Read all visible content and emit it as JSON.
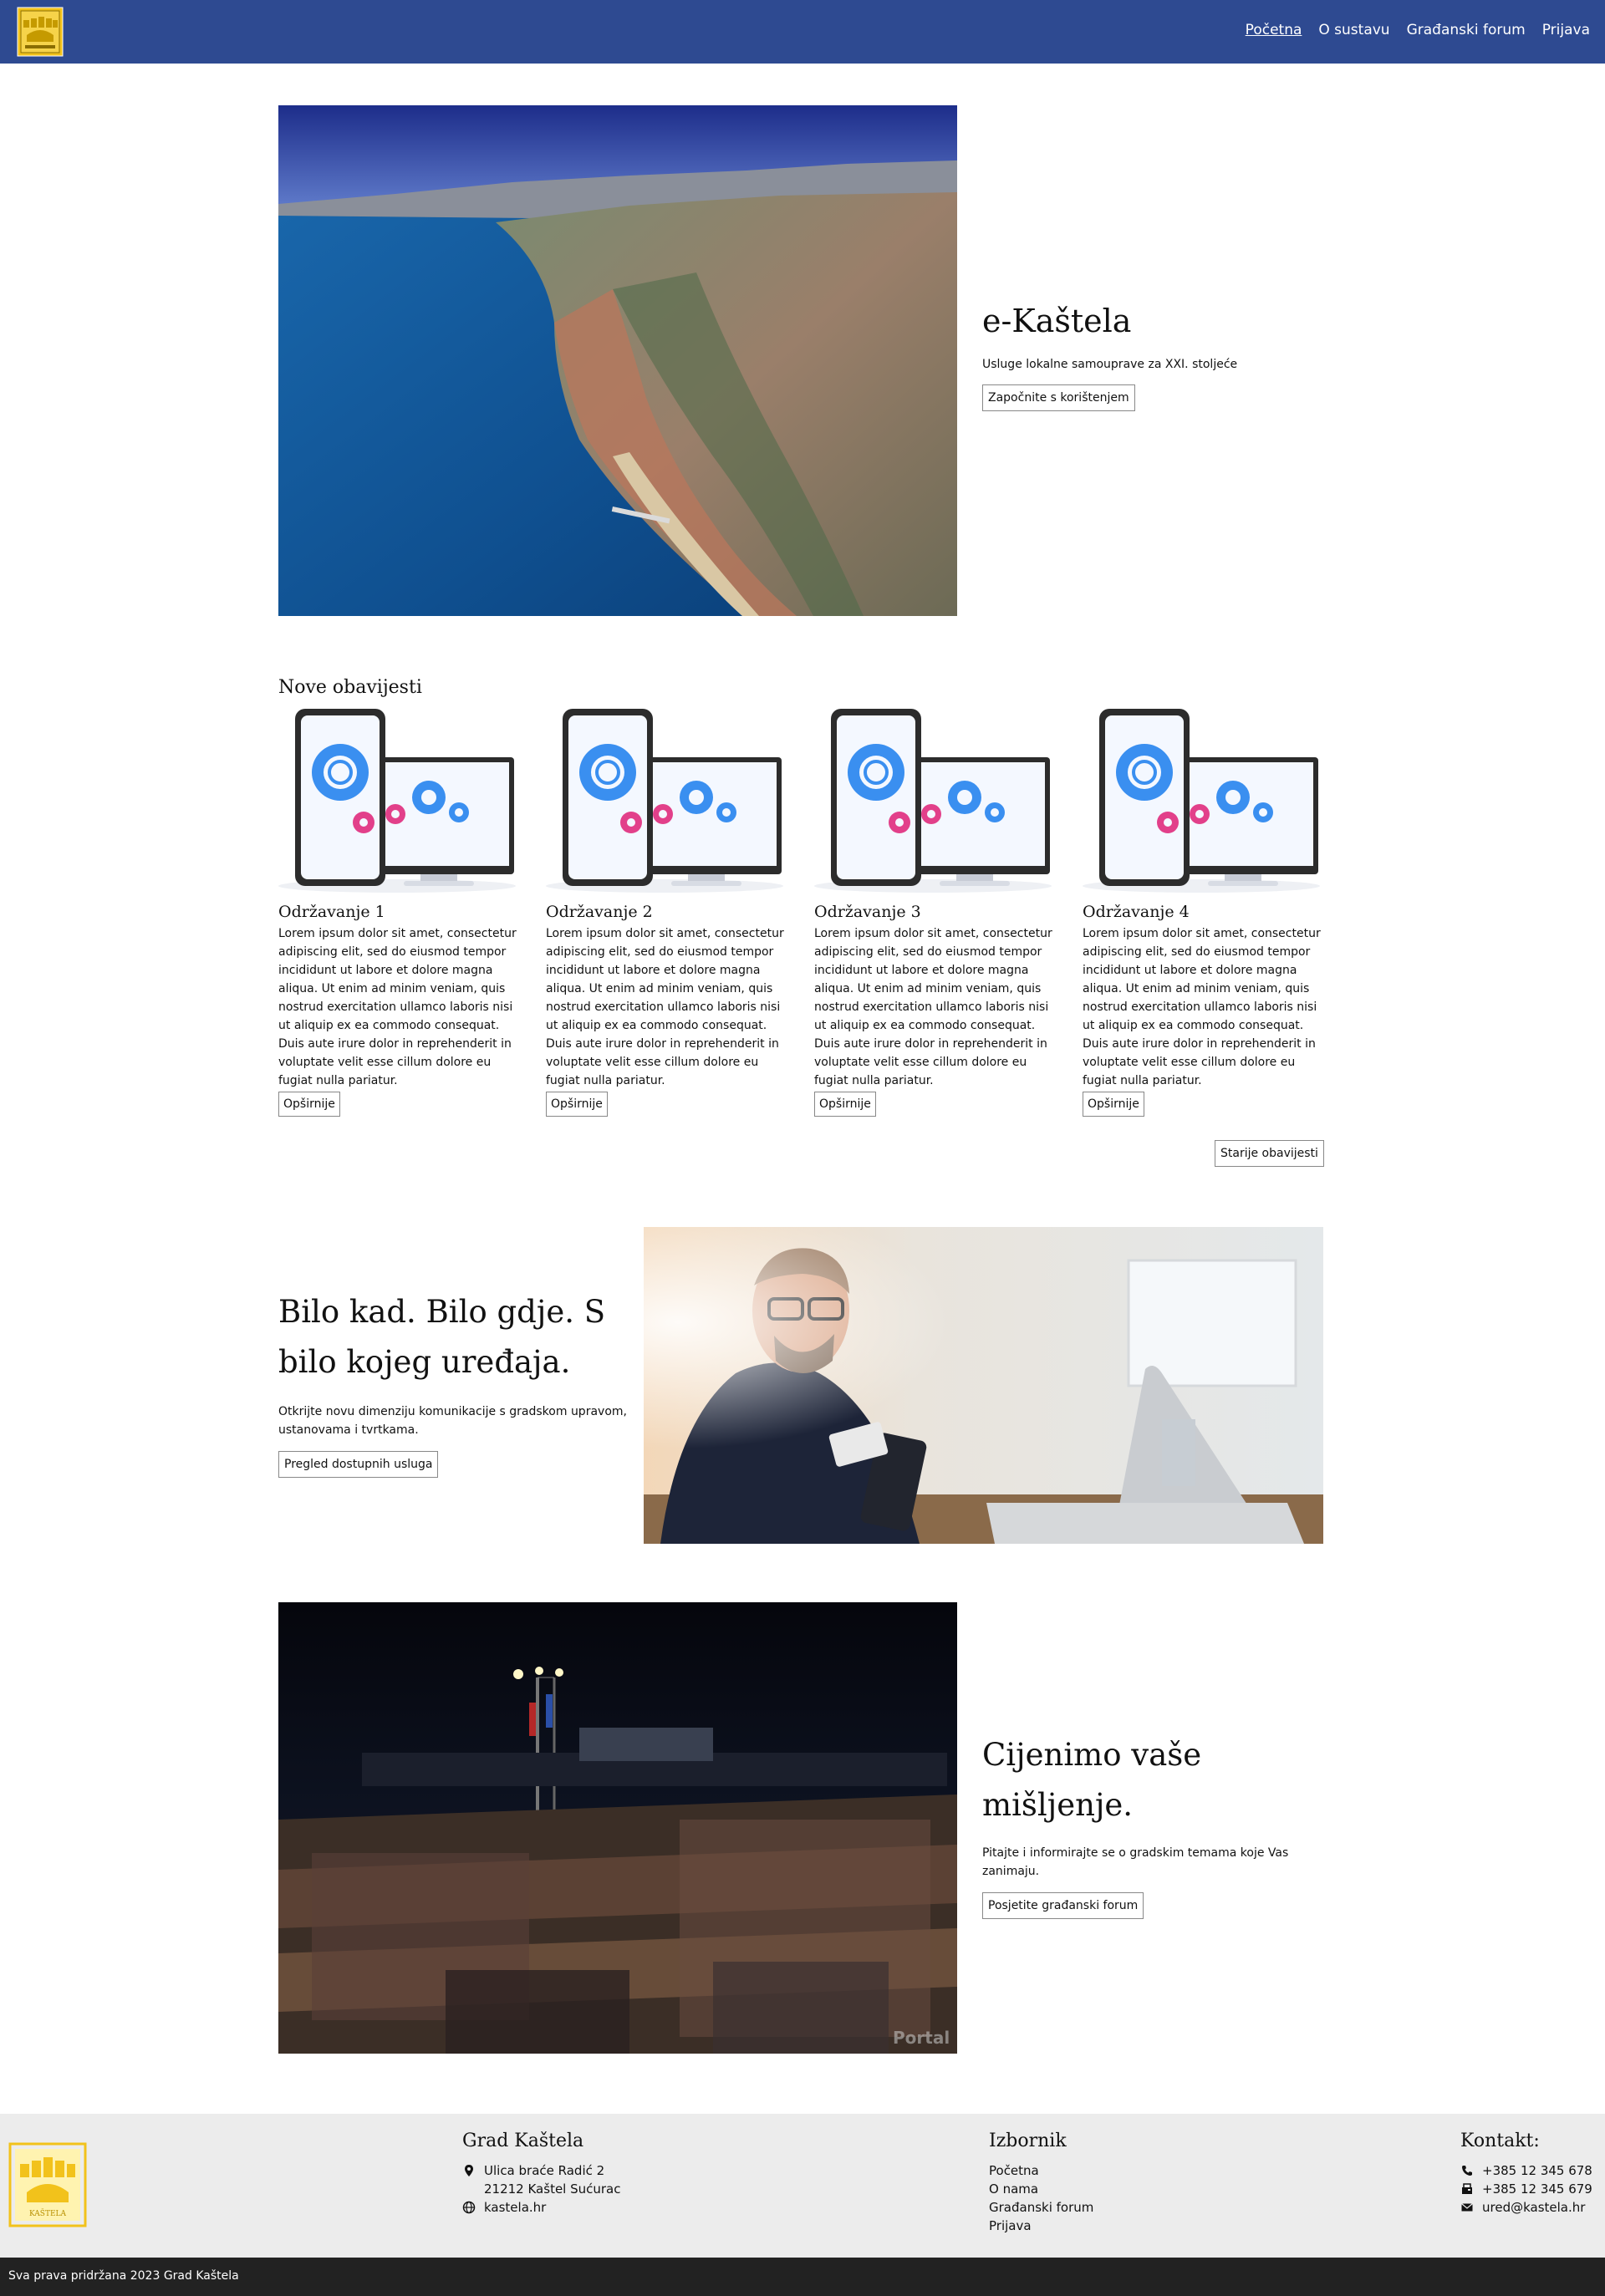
{
  "nav": {
    "logo_alt": "Grb Grada Kaštela",
    "items": [
      {
        "label": "Početna",
        "active": true
      },
      {
        "label": "O sustavu",
        "active": false
      },
      {
        "label": "Građanski forum",
        "active": false
      },
      {
        "label": "Prijava",
        "active": false
      }
    ]
  },
  "hero": {
    "title": "e-Kaštela",
    "subtitle": "Usluge lokalne samouprave za XXI. stoljeće",
    "button": "Započnite s korištenjem"
  },
  "news": {
    "heading": "Nove obavijesti",
    "items": [
      {
        "title": "Održavanje 1",
        "body": "Lorem ipsum dolor sit amet, consectetur adipiscing elit, sed do eiusmod tempor incididunt ut labore et dolore magna aliqua. Ut enim ad minim veniam, quis nostrud exercitation ullamco laboris nisi ut aliquip ex ea commodo consequat. Duis aute irure dolor in reprehenderit in voluptate velit esse cillum dolore eu fugiat nulla pariatur.",
        "button": "Opširnije"
      },
      {
        "title": "Održavanje 2",
        "body": "Lorem ipsum dolor sit amet, consectetur adipiscing elit, sed do eiusmod tempor incididunt ut labore et dolore magna aliqua. Ut enim ad minim veniam, quis nostrud exercitation ullamco laboris nisi ut aliquip ex ea commodo consequat. Duis aute irure dolor in reprehenderit in voluptate velit esse cillum dolore eu fugiat nulla pariatur.",
        "button": "Opširnije"
      },
      {
        "title": "Održavanje 3",
        "body": "Lorem ipsum dolor sit amet, consectetur adipiscing elit, sed do eiusmod tempor incididunt ut labore et dolore magna aliqua. Ut enim ad minim veniam, quis nostrud exercitation ullamco laboris nisi ut aliquip ex ea commodo consequat. Duis aute irure dolor in reprehenderit in voluptate velit esse cillum dolore eu fugiat nulla pariatur.",
        "button": "Opširnije"
      },
      {
        "title": "Održavanje 4",
        "body": "Lorem ipsum dolor sit amet, consectetur adipiscing elit, sed do eiusmod tempor incididunt ut labore et dolore magna aliqua. Ut enim ad minim veniam, quis nostrud exercitation ullamco laboris nisi ut aliquip ex ea commodo consequat. Duis aute irure dolor in reprehenderit in voluptate velit esse cillum dolore eu fugiat nulla pariatur.",
        "button": "Opširnije"
      }
    ],
    "older_button": "Starije obavijesti"
  },
  "section_devices": {
    "title": "Bilo kad. Bilo gdje. S bilo kojeg uređaja.",
    "subtitle": "Otkrijte novu dimenziju komunikacije s gradskom upravom, ustanovama i tvrtkama.",
    "button": "Pregled dostupnih usluga"
  },
  "section_opinion": {
    "title": "Cijenimo vaše mišljenje.",
    "subtitle": "Pitajte i informirajte se o gradskim temama koje Vas zanimaju.",
    "button": "Posjetite građanski forum",
    "watermark": "Portal"
  },
  "footer": {
    "city": {
      "heading": "Grad Kaštela",
      "address_line1": "Ulica braće Radić 2",
      "address_line2": "21212 Kaštel Sućurac",
      "website": "kastela.hr"
    },
    "menu": {
      "heading": "Izbornik",
      "items": [
        "Početna",
        "O nama",
        "Građanski forum",
        "Prijava"
      ]
    },
    "contact": {
      "heading": "Kontakt:",
      "phone": "+385 12 345 678",
      "fax": "+385 12 345 679",
      "email": "ured@kastela.hr"
    },
    "logo_text": "KAŠTELA"
  },
  "copyright": "Sva prava pridržana 2023 Grad Kaštela",
  "colors": {
    "nav_bg": "#2e4a91",
    "footer_bg": "#ececec",
    "copyright_bg": "#222222",
    "logo_yellow": "#f2c21b"
  }
}
